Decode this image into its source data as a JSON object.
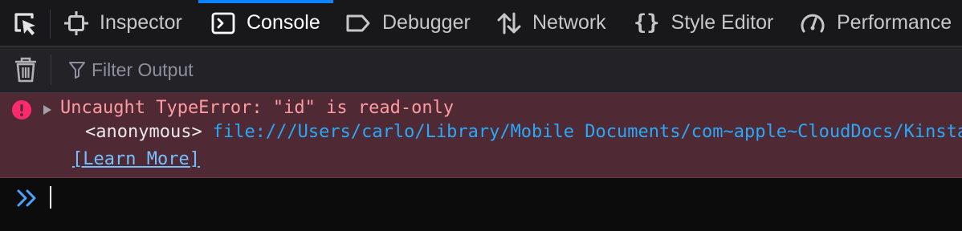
{
  "toolbar": {
    "picker_icon": "element-picker-icon",
    "tabs": [
      {
        "label": "Inspector",
        "icon": "inspector-icon"
      },
      {
        "label": "Console",
        "icon": "console-icon",
        "selected": true
      },
      {
        "label": "Debugger",
        "icon": "debugger-icon"
      },
      {
        "label": "Network",
        "icon": "network-icon"
      },
      {
        "label": "Style Editor",
        "icon": "style-editor-icon"
      },
      {
        "label": "Performance",
        "icon": "performance-icon"
      }
    ],
    "selected_tab_color": "#0a84ff"
  },
  "filterbar": {
    "clear_icon": "trash-icon",
    "filter_placeholder": "Filter Output"
  },
  "console": {
    "messages": [
      {
        "level": "error",
        "icon": "error-icon",
        "text": "Uncaught TypeError: \"id\" is read-only",
        "stack": [
          {
            "function": "<anonymous>",
            "location": "file:///Users/carlo/Library/Mobile Documents/com~apple~CloudDocs/Kinsta"
          }
        ],
        "learn_more": "[Learn More]"
      }
    ],
    "prompt_icon": "prompt-chevrons-icon",
    "input_value": ""
  },
  "colors": {
    "error_background": "#4f2a35",
    "error_text": "#ff9aa2",
    "link": "#2aa8f7",
    "accent": "#0a84ff"
  }
}
